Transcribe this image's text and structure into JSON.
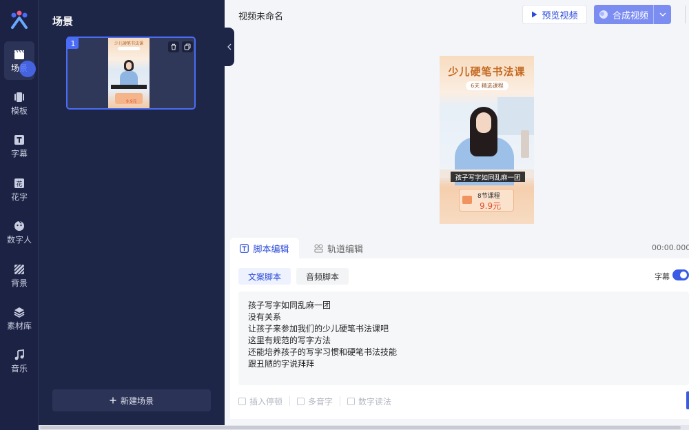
{
  "sidebar": {
    "items": [
      {
        "label": "场景",
        "icon": "clapperboard-icon"
      },
      {
        "label": "模板",
        "icon": "template-icon"
      },
      {
        "label": "字幕",
        "icon": "text-t-icon"
      },
      {
        "label": "花字",
        "icon": "fancy-text-icon"
      },
      {
        "label": "数字人",
        "icon": "digital-human-icon"
      },
      {
        "label": "背景",
        "icon": "background-pattern-icon"
      },
      {
        "label": "素材库",
        "icon": "layers-icon"
      },
      {
        "label": "音乐",
        "icon": "music-note-icon"
      }
    ]
  },
  "scene_panel": {
    "title": "场景",
    "cards": [
      {
        "number": "1",
        "thumb_title": "少儿硬笔书法课",
        "thumb_price": "9.9元"
      }
    ],
    "new_scene_label": "新建场景"
  },
  "header": {
    "title": "视频未命名",
    "preview_label": "预览视频",
    "compose_label": "合成视频"
  },
  "preview": {
    "title": "少儿硬笔书法课",
    "subtitle": "6天 精选课程",
    "caption": "孩子写字如同乱麻一团",
    "badge_title": "8节课程",
    "badge_price": "9.9元"
  },
  "editor": {
    "tabs": [
      {
        "label": "脚本编辑"
      },
      {
        "label": "轨道编辑"
      }
    ],
    "timecode": "00:00.000",
    "sub_tabs": [
      {
        "label": "文案脚本"
      },
      {
        "label": "音频脚本"
      }
    ],
    "subtitle_toggle_label": "字幕",
    "subtitle_toggle_on": true,
    "script_lines": [
      "孩子写字如同乱麻一团",
      "没有关系",
      "让孩子来参加我们的少儿硬笔书法课吧",
      "这里有规范的写字方法",
      "还能培养孩子的写字习惯和硬笔书法技能",
      "跟丑陋的字说拜拜"
    ],
    "tools": [
      {
        "label": "插入停顿"
      },
      {
        "label": "多音字"
      },
      {
        "label": "数字读法"
      }
    ]
  },
  "colors": {
    "accent": "#2b4bd9",
    "sidebar_bg": "#1b2243",
    "panel_bg": "#1e2647",
    "compose_button": "#7c8df2"
  }
}
